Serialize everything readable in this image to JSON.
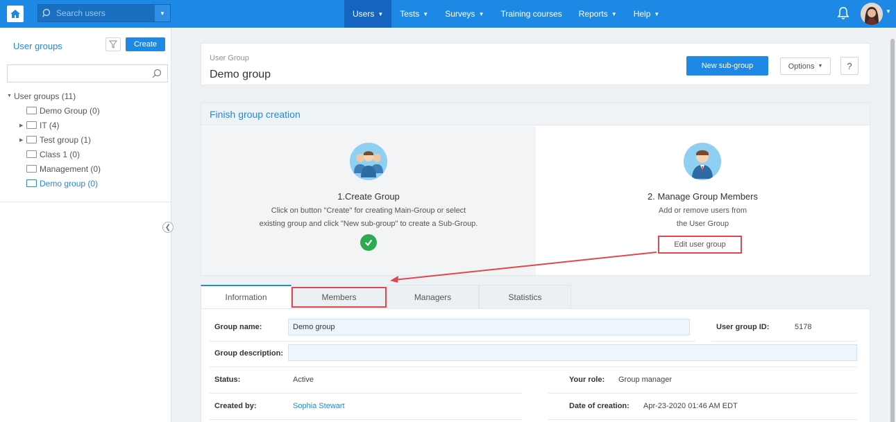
{
  "topbar": {
    "search_placeholder": "Search users",
    "nav": [
      {
        "label": "Users",
        "has_caret": true
      },
      {
        "label": "Tests",
        "has_caret": true
      },
      {
        "label": "Surveys",
        "has_caret": true
      },
      {
        "label": "Training courses",
        "has_caret": false
      },
      {
        "label": "Reports",
        "has_caret": true
      },
      {
        "label": "Help",
        "has_caret": true
      }
    ],
    "active_nav": "Users"
  },
  "sidebar": {
    "title": "User groups",
    "create_label": "Create",
    "tree_root": "User groups (11)",
    "items": [
      {
        "label": "Demo Group (0)",
        "expandable": false
      },
      {
        "label": "IT (4)",
        "expandable": true
      },
      {
        "label": "Test group (1)",
        "expandable": true
      },
      {
        "label": "Class 1 (0)",
        "expandable": false
      },
      {
        "label": "Management (0)",
        "expandable": false
      },
      {
        "label": "Demo group (0)",
        "expandable": false,
        "selected": true
      }
    ]
  },
  "header": {
    "subtitle": "User Group",
    "title": "Demo group",
    "new_subgroup_label": "New sub-group",
    "options_label": "Options",
    "help_label": "?"
  },
  "finish": {
    "title": "Finish group creation",
    "step1": {
      "title": "1.Create Group",
      "desc_line1": "Click on button \"Create\" for creating Main-Group or select",
      "desc_line2": "existing group and click \"New sub-group\" to create a Sub-Group."
    },
    "step2": {
      "title": "2. Manage Group Members",
      "desc_line1": "Add or remove users from",
      "desc_line2": "the User Group",
      "edit_label": "Edit user group"
    }
  },
  "tabs": {
    "information": "Information",
    "members": "Members",
    "managers": "Managers",
    "statistics": "Statistics"
  },
  "info": {
    "group_name_label": "Group name:",
    "group_name_value": "Demo group",
    "user_group_id_label": "User group ID:",
    "user_group_id_value": "5178",
    "group_description_label": "Group description:",
    "status_label": "Status:",
    "status_value": "Active",
    "your_role_label": "Your role:",
    "your_role_value": "Group manager",
    "created_by_label": "Created by:",
    "created_by_value": "Sophia Stewart",
    "date_of_creation_label": "Date of creation:",
    "date_of_creation_value": "Apr-23-2020 01:46 AM EDT"
  },
  "colors": {
    "brand": "#1e88e5",
    "highlight": "#e0474c",
    "success": "#2eaa52"
  }
}
